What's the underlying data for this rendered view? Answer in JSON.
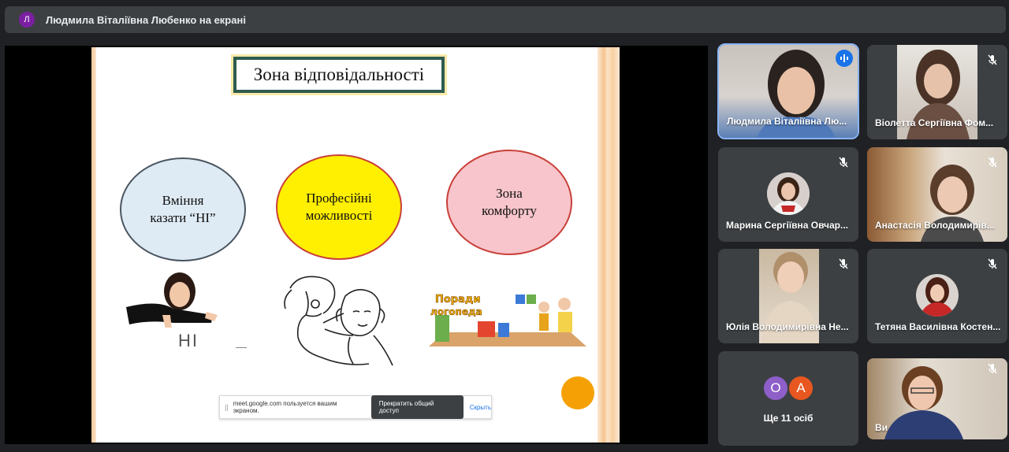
{
  "banner": {
    "avatar_letter": "Л",
    "text": "Людмила Віталіївна Любенко на екрані"
  },
  "slide": {
    "title": "Зона відповідальності",
    "ovals": [
      {
        "label": "Вміння\nказати “НІ”"
      },
      {
        "label": "Професійні\nможливості"
      },
      {
        "label": "Зона\nкомфорту"
      }
    ],
    "sign_text": "НІ",
    "poradi_text_1": "Поради",
    "poradi_text_2": "логопеда",
    "colors": {
      "oval1": "#deebf5",
      "oval2": "#ffef00",
      "oval3": "#f7c5cb",
      "dot": "#f5a106"
    }
  },
  "share_bar": {
    "handle": "||",
    "message": "meet.google.com пользуется вашим экраном.",
    "stop_label": "Прекратить общий доступ",
    "hide_label": "Скрыть"
  },
  "participants": [
    {
      "name": "Людмила Віталіївна Лю...",
      "status": "speaking",
      "icon": "audio-level-icon"
    },
    {
      "name": "Віолетта Сергіївна Фом...",
      "status": "muted",
      "icon": "mic-off-icon"
    },
    {
      "name": "Марина Сергіївна Овчар...",
      "status": "muted",
      "icon": "mic-off-icon"
    },
    {
      "name": "Анастасія Володимирів...",
      "status": "muted",
      "icon": "mic-off-icon"
    },
    {
      "name": "Юлія Володимирівна Не...",
      "status": "muted",
      "icon": "mic-off-icon"
    },
    {
      "name": "Тетяна Василівна Костен...",
      "status": "muted",
      "icon": "mic-off-icon"
    },
    {
      "name": "Ви",
      "status": "muted",
      "icon": "mic-off-icon"
    }
  ],
  "more": {
    "avatar_1": "О",
    "avatar_2": "А",
    "label": "Ще 11 осіб",
    "colors": [
      "#8e5fc9",
      "#e8571f"
    ]
  }
}
